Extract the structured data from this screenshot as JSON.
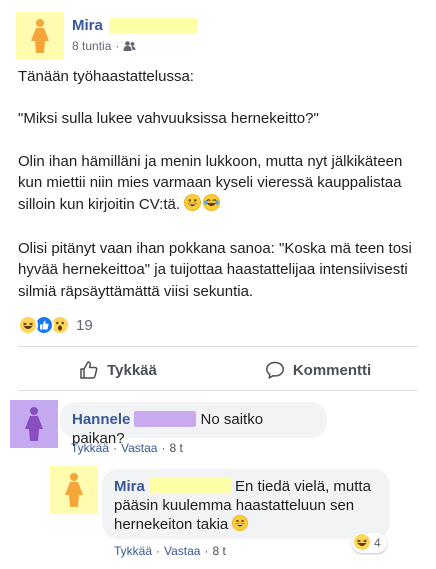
{
  "post": {
    "author": "Mira",
    "time": "8 tuntia",
    "paragraphs": [
      "Tänään työhaastattelussa:",
      "\"Miksi sulla lukee vahvuuksissa hernekeitto?\"",
      "Olin ihan hämilläni ja menin lukkoon, mutta nyt jälkikäteen kun miettii niin mies varmaan kyseli vieressä kauppalistaa silloin kun kirjoitin CV:tä.",
      "Olisi pitänyt vaan ihan pokkana sanoa: \"Koska mä teen tosi hyvää hernekeittoa\" ja tuijottaa haastattelijaa intensiivisesti silmiä räpsäyttämättä viisi sekuntia."
    ],
    "reaction_count": "19",
    "reaction_icons": [
      "laugh-icon",
      "like-icon",
      "wow-icon"
    ],
    "audience_icon": "friends-icon"
  },
  "actions": {
    "like": "Tykkää",
    "comment": "Kommentti"
  },
  "comments": [
    {
      "author": "Hannele",
      "text": "No saitko paikan?",
      "like": "Tykkää",
      "reply": "Vastaa",
      "time": "8 t"
    },
    {
      "author": "Mira",
      "text": "En tiedä vielä, mutta pääsin kuulemma haastatteluun sen hernekeiton takia",
      "like": "Tykkää",
      "reply": "Vastaa",
      "time": "8 t",
      "reaction_count": "4"
    }
  ],
  "colors": {
    "link": "#385898",
    "author_highlight": "#ffffa8",
    "commenter_highlight": "#c9a9f0",
    "mira_avatar_bg": "#fffcb0",
    "hannele_avatar_bg": "#c5a9f0",
    "bubble_bg": "#f2f3f5"
  }
}
